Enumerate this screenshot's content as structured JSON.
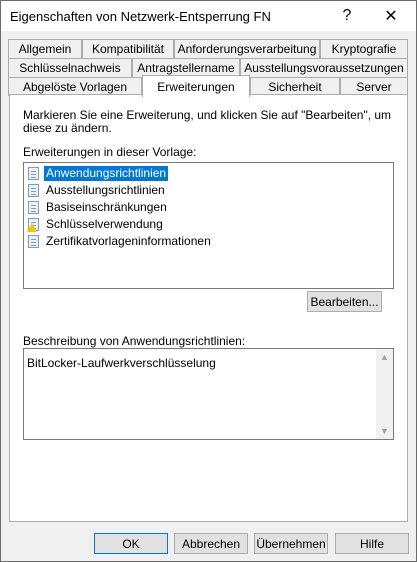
{
  "window": {
    "title": "Eigenschaften von Netzwerk-Entsperrung FN",
    "help_glyph": "?",
    "close_glyph": "✕"
  },
  "tabs": {
    "row1": [
      "Allgemein",
      "Kompatibilität",
      "Anforderungsverarbeitung",
      "Kryptografie"
    ],
    "row2": [
      "Schlüsselnachweis",
      "Antragstellername",
      "Ausstellungsvoraussetzungen"
    ],
    "row3": [
      "Abgelöste Vorlagen",
      "Erweiterungen",
      "Sicherheit",
      "Server"
    ],
    "active": "Erweiterungen"
  },
  "instructions": "Markieren Sie eine Erweiterung, und klicken Sie auf \"Bearbeiten\", um diese zu ändern.",
  "extensions": {
    "label": "Erweiterungen in dieser Vorlage:",
    "items": [
      {
        "label": "Anwendungsrichtlinien",
        "icon": "document-icon",
        "selected": true
      },
      {
        "label": "Ausstellungsrichtlinien",
        "icon": "document-icon",
        "selected": false
      },
      {
        "label": "Basiseinschränkungen",
        "icon": "document-icon",
        "selected": false
      },
      {
        "label": "Schlüsselverwendung",
        "icon": "warning-document-icon",
        "selected": false
      },
      {
        "label": "Zertifikatvorlageninformationen",
        "icon": "document-icon",
        "selected": false
      }
    ]
  },
  "edit_button": "Bearbeiten...",
  "description": {
    "label": "Beschreibung von Anwendungsrichtlinien:",
    "text": "BitLocker-Laufwerkverschlüsselung"
  },
  "buttons": {
    "ok": "OK",
    "cancel": "Abbrechen",
    "apply": "Übernehmen",
    "help": "Hilfe"
  },
  "colors": {
    "selection": "#0078d7",
    "default_button_border": "#0078d7",
    "warning": "#f5c400"
  }
}
